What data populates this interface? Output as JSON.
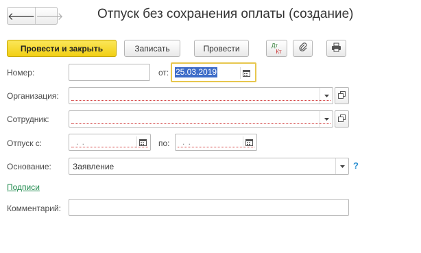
{
  "window": {
    "title": "Отпуск без сохранения оплаты (создание)"
  },
  "nav": {
    "back_glyph": "🡐",
    "forward_glyph": "🡒"
  },
  "toolbar": {
    "post_and_close_label": "Провести и закрыть",
    "save_label": "Записать",
    "post_label": "Провести",
    "dt_kt_top": "Дт",
    "dt_kt_bottom": "Кт",
    "attach_icon": "paperclip-icon",
    "print_icon": "printer-icon"
  },
  "form": {
    "number": {
      "label": "Номер:",
      "value": ""
    },
    "date": {
      "label": "от:",
      "value": "25.03.2019"
    },
    "organization": {
      "label": "Организация:",
      "value": ""
    },
    "employee": {
      "label": "Сотрудник:",
      "value": ""
    },
    "leave_from": {
      "label": "Отпуск с:",
      "value": ". ."
    },
    "leave_to": {
      "label": "по:",
      "value": ". ."
    },
    "basis": {
      "label": "Основание:",
      "value": "Заявление"
    },
    "signatures_link": "Подписи",
    "comment": {
      "label": "Комментарий:",
      "value": ""
    },
    "help_glyph": "?"
  },
  "colors": {
    "primary_button": "#f2cf14",
    "link": "#1f8a4d",
    "required_underline": "#d23a3a",
    "focus_border": "#e7c74e",
    "selection": "#3d6cc8",
    "help": "#2a8fd1"
  }
}
